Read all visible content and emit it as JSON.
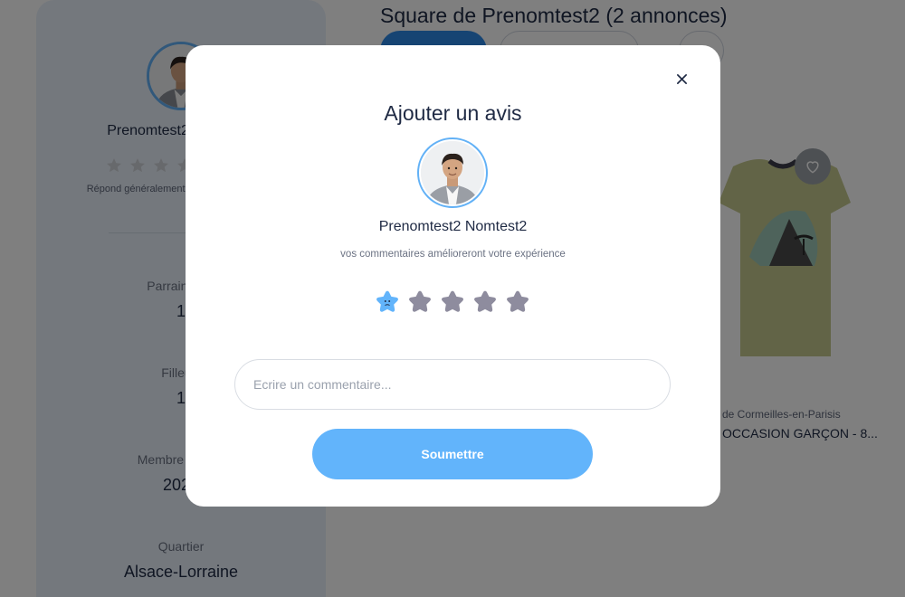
{
  "background": {
    "page_title": "Square de Prenomtest2 (2 annonces)",
    "profile": {
      "name": "Prenomtest2 Nomtest2",
      "respond_text": "Répond généralement en quelques heures",
      "stats": [
        {
          "label": "Parrainages",
          "value": "1"
        },
        {
          "label": "Filleuls",
          "value": "1"
        },
        {
          "label": "Membre depuis",
          "value": "2023"
        },
        {
          "label": "Quartier",
          "value": "Alsace-Lorraine"
        }
      ]
    },
    "product": {
      "location": "de Cormeilles-en-Parisis",
      "title": "OCCASION GARÇON - 8..."
    }
  },
  "modal": {
    "title": "Ajouter un avis",
    "user_name": "Prenomtest2 Nomtest2",
    "subtitle": "vos commentaires amélioreront votre expérience",
    "rating": {
      "max": 5,
      "selected": 1
    },
    "comment": {
      "placeholder": "Ecrire un commentaire...",
      "value": ""
    },
    "submit_label": "Soumettre",
    "close_icon": "close-icon"
  },
  "colors": {
    "accent": "#62b4fb",
    "avatar_border": "#62b1f6",
    "star_inactive": "#8e8c9e",
    "text_primary": "#1f2a44",
    "overlay": "rgba(0,0,0,0.5)"
  }
}
